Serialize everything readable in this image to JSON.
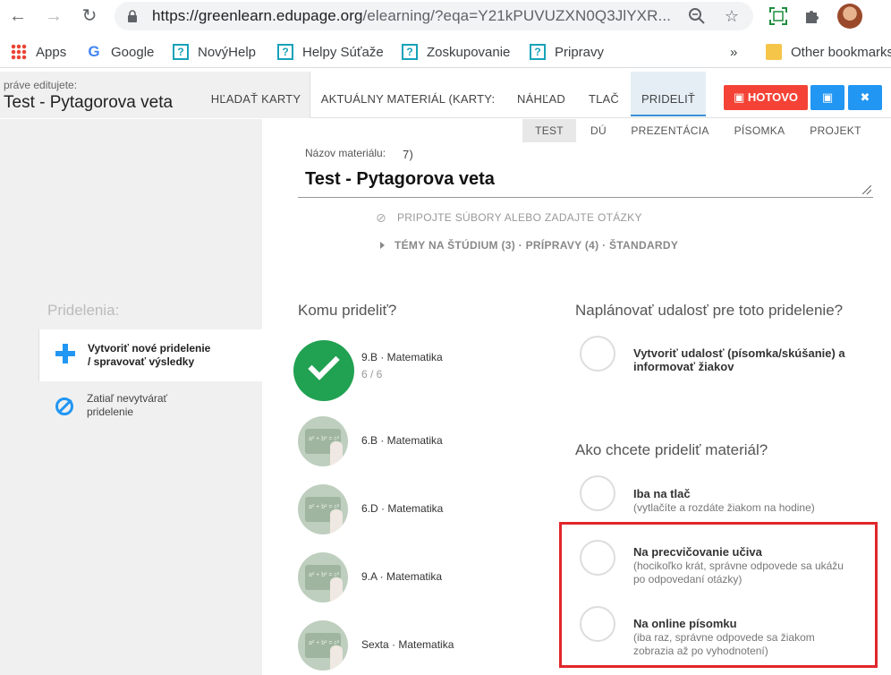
{
  "browser": {
    "url_host": "https://greenlearn.edupage.org",
    "url_path": "/elearning/?eqa=Y21kPUVUZXN0Q3JlYXR...",
    "bookmarks": [
      "Apps",
      "Google",
      "NovýHelp",
      "Helpy Súťaže",
      "Zoskupovanie",
      "Pripravy"
    ],
    "more": "»",
    "other_bookmarks": "Other bookmarks",
    "icons": {
      "back": "arrow-left-icon",
      "forward": "arrow-right-icon",
      "reload": "reload-icon",
      "lock": "lock-icon",
      "zoom": "zoom-icon",
      "star": "star-icon",
      "screen": "screen-capture-icon",
      "extensions": "puzzle-icon"
    }
  },
  "header": {
    "editing_label": "práve editujete:",
    "title": "Test - Pytagorova veta",
    "tabs": [
      "HĽADAŤ KARTY",
      "AKTUÁLNY MATERIÁL (KARTY: 7)",
      "NÁHĽAD",
      "TLAČ",
      "PRIDELIŤ"
    ],
    "done_label": "HOTOVO",
    "accent_red": "#f44336",
    "accent_blue": "#2196f3"
  },
  "material": {
    "types": [
      "TEST",
      "DÚ",
      "PREZENTÁCIA",
      "PÍSOMKA",
      "PROJEKT"
    ],
    "name_label": "Názov materiálu:",
    "name_value": "Test - Pytagorova veta",
    "attach": "PRIPOJTE SÚBORY ALEBO ZADAJTE OTÁZKY",
    "topics": "TÉMY NA ŠTÚDIUM (3) · PRÍPRAVY (4) · ŠTANDARDY"
  },
  "sidebar": {
    "title": "Pridelenia:",
    "items": [
      {
        "label_1": "Vytvoriť nové pridelenie",
        "label_2": "/ spravovať výsledky"
      },
      {
        "label_1": "Zatiaľ nevytvárať",
        "label_2": "pridelenie"
      }
    ]
  },
  "assign": {
    "title": "Komu prideliť?",
    "classes": [
      {
        "label": "9.B · Matematika",
        "count": "6 / 6",
        "selected": true
      },
      {
        "label": "6.B · Matematika"
      },
      {
        "label": "6.D · Matematika"
      },
      {
        "label": "9.A · Matematika"
      },
      {
        "label": "Sexta · Matematika"
      }
    ]
  },
  "schedule": {
    "title": "Naplánovať udalosť pre toto pridelenie?",
    "option": {
      "title_1": "Vytvoriť udalosť (písomka/skúšanie) a",
      "title_2": "informovať žiakov"
    }
  },
  "mode": {
    "title": "Ako chcete prideliť materiál?",
    "options": [
      {
        "title": "Iba na tlač",
        "desc_1": "(vytlačíte a rozdáte žiakom na hodine)",
        "desc_2": ""
      },
      {
        "title": "Na precvičovanie učiva",
        "desc_1": "(hocikoľko krát, správne odpovede sa ukážu",
        "desc_2": "po odpovedaní otázky)"
      },
      {
        "title": "Na online písomku",
        "desc_1": "(iba raz, správne odpovede sa žiakom",
        "desc_2": "zobrazia až po vyhodnotení)"
      }
    ],
    "highlight_color": "#e0262a"
  }
}
